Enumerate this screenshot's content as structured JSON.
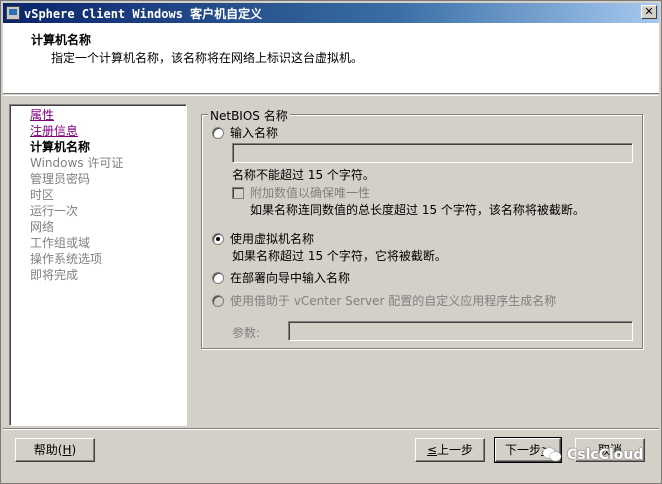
{
  "window": {
    "title": "vSphere Client Windows 客户机自定义",
    "close_label": "✕"
  },
  "header": {
    "title": "计算机名称",
    "description": "指定一个计算机名称，该名称将在网络上标识这台虚拟机。"
  },
  "nav": {
    "items": [
      {
        "label": "属性",
        "state": "link"
      },
      {
        "label": "注册信息",
        "state": "link"
      },
      {
        "label": "计算机名称",
        "state": "current"
      },
      {
        "label": "Windows 许可证",
        "state": "pending"
      },
      {
        "label": "管理员密码",
        "state": "pending"
      },
      {
        "label": "时区",
        "state": "pending"
      },
      {
        "label": "运行一次",
        "state": "pending"
      },
      {
        "label": "网络",
        "state": "pending"
      },
      {
        "label": "工作组或域",
        "state": "pending"
      },
      {
        "label": "操作系统选项",
        "state": "pending"
      },
      {
        "label": "即将完成",
        "state": "pending"
      }
    ]
  },
  "netbios": {
    "legend": "NetBIOS 名称",
    "enter_name_label": "输入名称",
    "enter_name_selected": false,
    "name_value": "",
    "name_hint": "名称不能超过 15 个字符。",
    "append_number_label": "附加数值以确保唯一性",
    "append_number_checked": false,
    "append_number_hint": "如果名称连同数值的总长度超过 15 个字符，该名称将被截断。",
    "use_vm_name_label": "使用虚拟机名称",
    "use_vm_name_selected": true,
    "use_vm_name_hint": "如果名称超过 15 个字符，它将被截断。",
    "deploy_wizard_label": "在部署向导中输入名称",
    "deploy_wizard_selected": false,
    "vcenter_app_label": "使用借助于 vCenter Server 配置的自定义应用程序生成名称",
    "vcenter_app_selected": false,
    "params_label": "参数:",
    "params_value": ""
  },
  "footer": {
    "help_label": "帮助(",
    "help_key": "H",
    "help_suffix": ")",
    "back_key": "≤",
    "back_label": "上一步",
    "next_label": "下一步",
    "next_suffix": "≥",
    "cancel_label": "取消"
  },
  "watermark": {
    "text": "CslcCloud",
    "icon": "wechat-icon"
  }
}
